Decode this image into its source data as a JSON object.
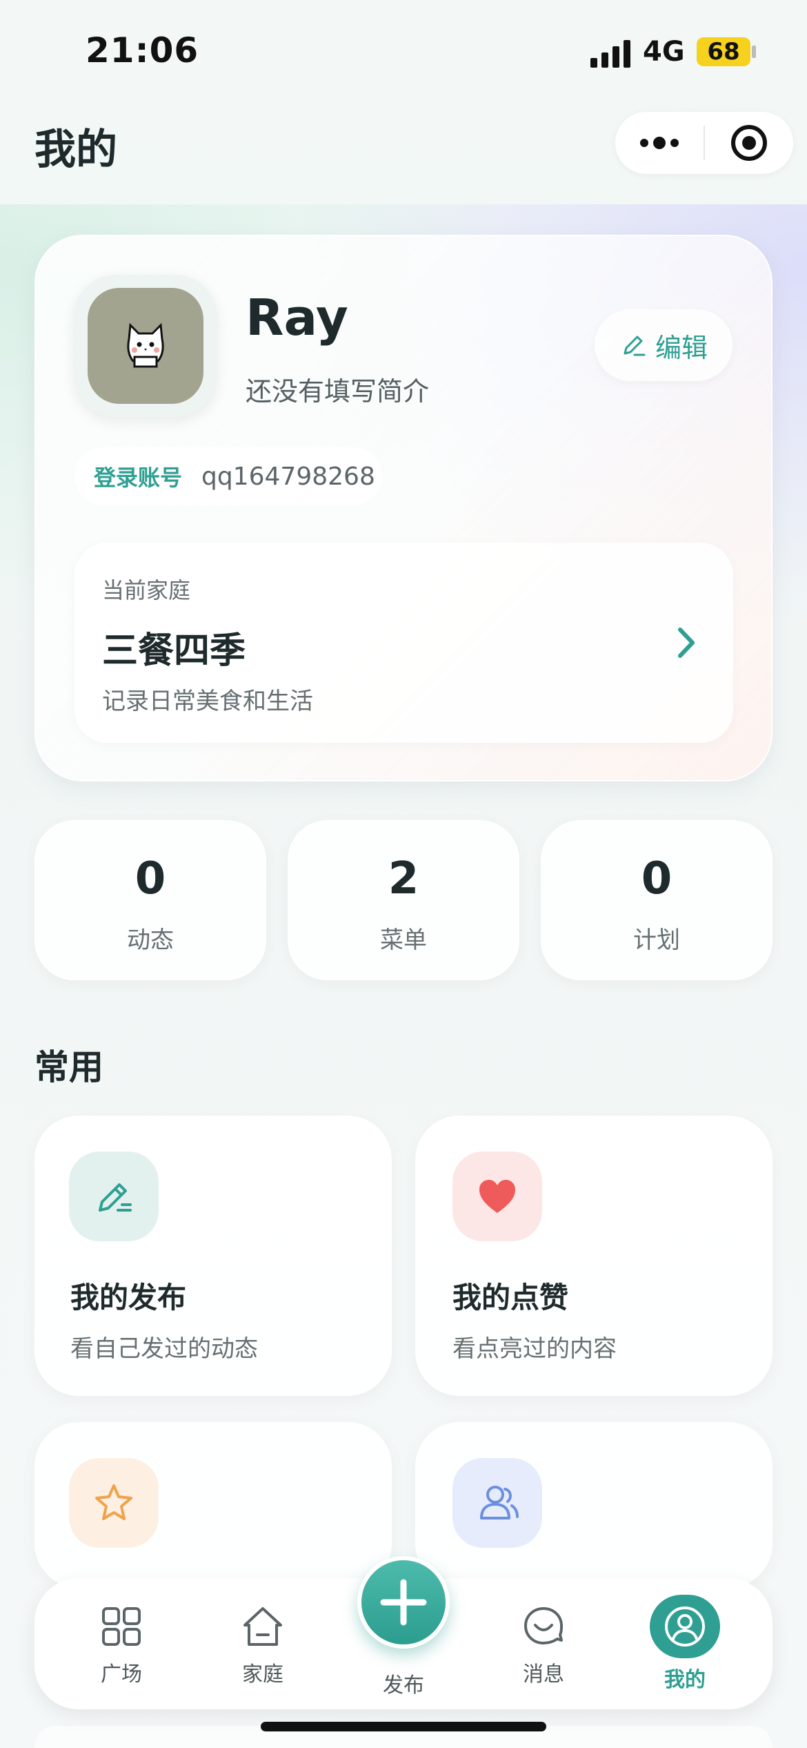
{
  "status_bar": {
    "time": "21:06",
    "network": "4G",
    "battery": "68"
  },
  "header": {
    "title": "我的"
  },
  "profile": {
    "name": "Ray",
    "bio": "还没有填写简介",
    "edit_label": "编辑",
    "account_key": "登录账号",
    "account_value": "qq164798268"
  },
  "family": {
    "kicker": "当前家庭",
    "name": "三餐四季",
    "desc": "记录日常美食和生活"
  },
  "stats": [
    {
      "value": "0",
      "label": "动态"
    },
    {
      "value": "2",
      "label": "菜单"
    },
    {
      "value": "0",
      "label": "计划"
    }
  ],
  "section": {
    "title": "常用"
  },
  "tiles": [
    {
      "title": "我的发布",
      "sub": "看自己发过的动态",
      "icon": "pencil-icon",
      "color": "#2e9f92"
    },
    {
      "title": "我的点赞",
      "sub": "看点亮过的内容",
      "icon": "heart-icon",
      "color": "#ef5a5a"
    },
    {
      "title": "",
      "sub": "",
      "icon": "star-icon",
      "color": "#f0a24a"
    },
    {
      "title": "",
      "sub": "",
      "icon": "users-icon",
      "color": "#6a8fe0"
    }
  ],
  "tabbar": {
    "items": [
      {
        "label": "广场",
        "icon": "grid-icon"
      },
      {
        "label": "家庭",
        "icon": "home-icon"
      },
      {
        "label": "发布",
        "icon": "plus-icon"
      },
      {
        "label": "消息",
        "icon": "chat-icon"
      },
      {
        "label": "我的",
        "icon": "user-icon"
      }
    ],
    "active": "我的"
  },
  "colors": {
    "accent": "#2e9f92",
    "text": "#1f2a2c",
    "muted": "#666f72"
  }
}
